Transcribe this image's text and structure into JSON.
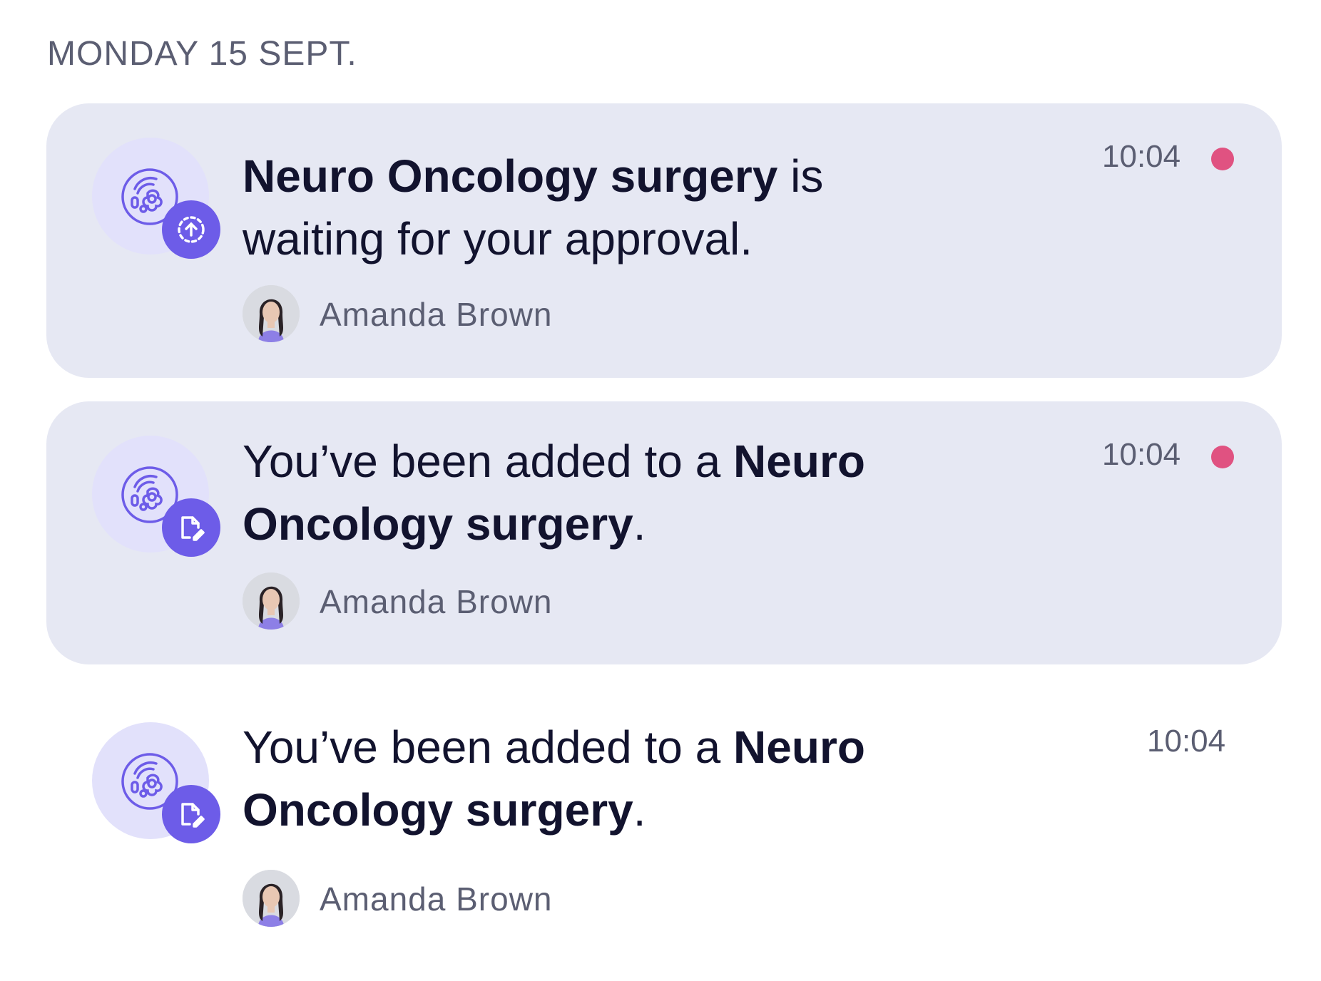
{
  "date_heading": "MONDAY 15 SEPT.",
  "colors": {
    "unread_card_bg": "#e6e8f3",
    "accent_purple": "#6d5ce8",
    "icon_circle_bg": "#e2e1fb",
    "unread_dot": "#e05281"
  },
  "notifications": [
    {
      "status": "unread",
      "icon": "cell-icon",
      "badge_icon": "upload-circle-icon",
      "text_bold_1": "Neuro Oncology surgery",
      "text_plain_1": " is waiting for your approval.",
      "time": "10:04",
      "author": "Amanda Brown"
    },
    {
      "status": "unread",
      "icon": "cell-icon",
      "badge_icon": "document-edit-icon",
      "text_plain_1": "You’ve been added to a ",
      "text_bold_1": "Neuro Oncology surgery",
      "text_plain_2": ".",
      "time": "10:04",
      "author": "Amanda Brown"
    },
    {
      "status": "read",
      "icon": "cell-icon",
      "badge_icon": "document-edit-icon",
      "text_plain_1": "You’ve been added to a ",
      "text_bold_1": "Neuro Oncology surgery",
      "text_plain_2": ".",
      "time": "10:04",
      "author": "Amanda Brown"
    }
  ]
}
